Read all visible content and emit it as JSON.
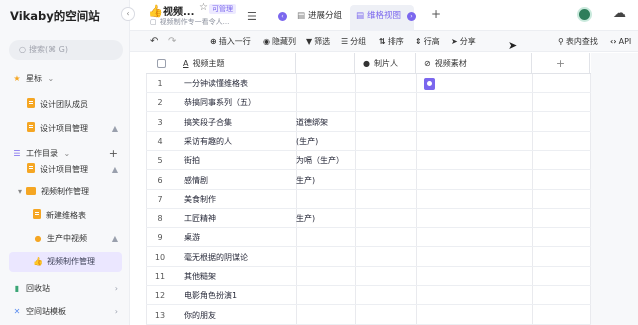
{
  "sidebar": {
    "space_title": "Vikaby的空间站",
    "collapse_glyph": "‹",
    "search_placeholder": "搜索(⌘ G)",
    "starred_label": "星标",
    "starred_items": [
      {
        "label": "设计团队成员"
      },
      {
        "label": "设计项目管理"
      }
    ],
    "catalog_label": "工作目录",
    "catalog_items": [
      {
        "label": "设计项目管理"
      },
      {
        "label": "视频制作管理"
      },
      {
        "label": "新建维格表"
      },
      {
        "label": "生产中视频"
      },
      {
        "label": "视频制作管理"
      }
    ],
    "recycle_label": "回收站",
    "template_label": "空间站模板"
  },
  "header": {
    "node_emoji": "👍",
    "node_title": "视频...",
    "role_badge": "可管理",
    "node_desc": "视频制作专一看令人...",
    "tabs": [
      {
        "label": "进展分组"
      },
      {
        "label": "维格视图"
      }
    ],
    "add_tab": "+"
  },
  "toolbar": {
    "insert_row": "插入一行",
    "hide_columns": "隐藏列",
    "filter": "筛选",
    "group": "分组",
    "sort": "排序",
    "row_height": "行高",
    "share": "分享",
    "find_in_table": "表内查找",
    "api": "API"
  },
  "grid": {
    "columns": [
      {
        "label": "视频主题"
      },
      {
        "label": ""
      },
      {
        "label": "制片人"
      },
      {
        "label": "视频素材"
      },
      {
        "label": "+"
      }
    ],
    "rows": [
      {
        "num": "1",
        "topic": "一分钟读懂维格表",
        "col2": "",
        "producer": "",
        "has_attachment": true
      },
      {
        "num": "2",
        "topic": "恭搞同事系列（五）",
        "col2": "",
        "producer": "",
        "has_attachment": false
      },
      {
        "num": "3",
        "topic": "搞笑段子合集",
        "col2": "道德绑架",
        "producer": "",
        "has_attachment": false
      },
      {
        "num": "4",
        "topic": "采访有趣的人",
        "col2": "(生产)",
        "producer": "",
        "has_attachment": false
      },
      {
        "num": "5",
        "topic": "街拍",
        "col2": "为嗝（生产）",
        "producer": "",
        "has_attachment": false
      },
      {
        "num": "6",
        "topic": "感情剧",
        "col2": "生产)",
        "producer": "",
        "has_attachment": false
      },
      {
        "num": "7",
        "topic": "美食制作",
        "col2": "",
        "producer": "",
        "has_attachment": false
      },
      {
        "num": "8",
        "topic": "工匠精神",
        "col2": "生产)",
        "producer": "",
        "has_attachment": false
      },
      {
        "num": "9",
        "topic": "桌游",
        "col2": "",
        "producer": "",
        "has_attachment": false
      },
      {
        "num": "10",
        "topic": "毫无根据的阴谋论",
        "col2": "",
        "producer": "",
        "has_attachment": false
      },
      {
        "num": "11",
        "topic": "其他糙架",
        "col2": "",
        "producer": "",
        "has_attachment": false
      },
      {
        "num": "12",
        "topic": "电影角色扮演1",
        "col2": "",
        "producer": "",
        "has_attachment": false
      },
      {
        "num": "13",
        "topic": "你的朋友",
        "col2": "",
        "producer": "",
        "has_attachment": false
      }
    ]
  },
  "colors": {
    "accent": "#7b67ee",
    "badge_bg": "#edeaff",
    "active_row_bg": "#ebe7ff",
    "folder": "#f5a623"
  },
  "icons": [
    "search-icon",
    "star-icon",
    "chevron-down-icon",
    "plus-icon",
    "lock-icon",
    "trash-icon",
    "template-icon",
    "undo-icon",
    "redo-icon",
    "filter-icon",
    "attachment-icon",
    "cursor-icon"
  ]
}
